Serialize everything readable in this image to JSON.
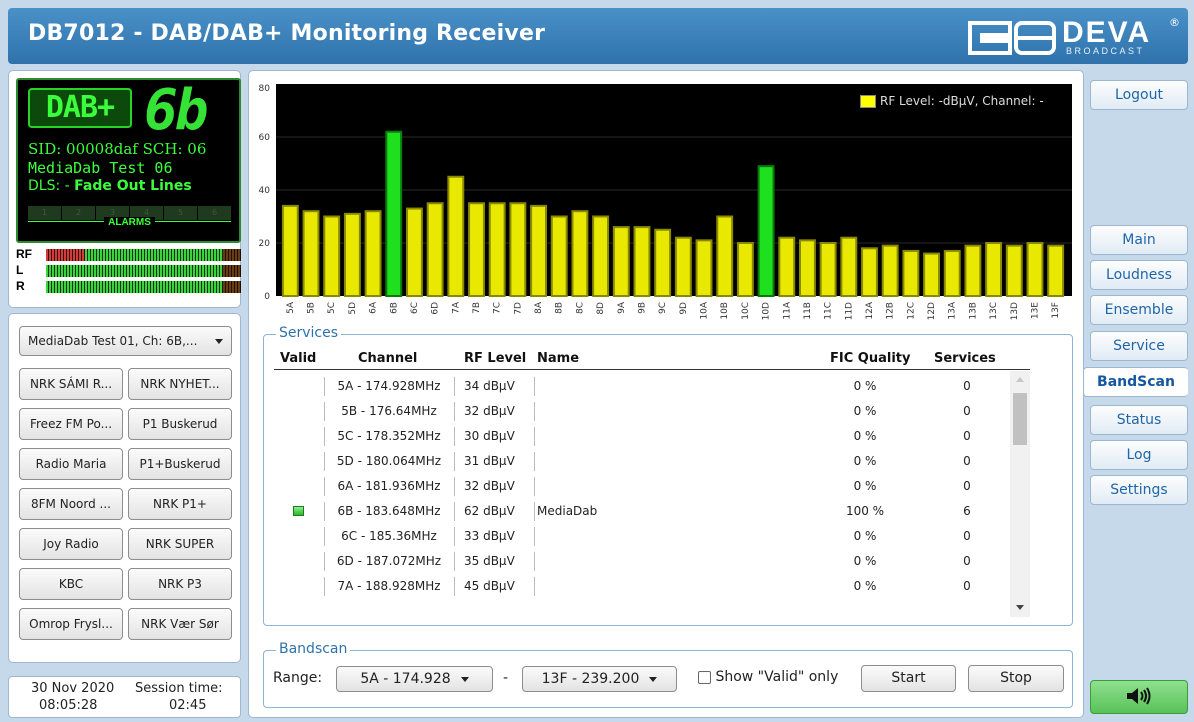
{
  "header": {
    "title": "DB7012 - DAB/DAB+ Monitoring Receiver",
    "logo_word": "DEVA",
    "logo_sub": "BROADCAST",
    "logo_reg": "®"
  },
  "display": {
    "dab_logo": "DAB+",
    "channel": "6b",
    "sid_line": "SID: 00008daf  SCH: 06",
    "ensemble": "MediaDab Test 06",
    "dls_prefix": "DLS: -",
    "dls_text": "Fade Out Lines",
    "alarm_numbers": [
      "1",
      "2",
      "3",
      "4",
      "5",
      "6"
    ],
    "alarms_label": "ALARMS"
  },
  "meters": [
    {
      "label": "RF",
      "level": 0.95,
      "red": 0.2
    },
    {
      "label": "L",
      "level": 0.9,
      "red": 0
    },
    {
      "label": "R",
      "level": 0.9,
      "red": 0
    }
  ],
  "presets": {
    "selected": "MediaDab Test 01, Ch: 6B,...",
    "buttons": [
      "NRK SÁMI R...",
      "NRK NYHET...",
      "Freez FM Po...",
      "P1 Buskerud",
      "Radio Maria",
      "P1+Buskerud",
      "8FM Noord ...",
      "NRK P1+",
      "Joy Radio",
      "NRK SUPER",
      "KBC",
      "NRK P3",
      "Omrop Frysl...",
      "NRK Vær Sør"
    ]
  },
  "footer": {
    "date": "30 Nov 2020",
    "time": "08:05:28",
    "session_label": "Session time:",
    "session_value": "02:45"
  },
  "nav": {
    "logout": "Logout",
    "items": [
      "Main",
      "Loudness",
      "Ensemble",
      "Service",
      "BandScan",
      "Status",
      "Log",
      "Settings"
    ],
    "active": "BandScan"
  },
  "chart_data": {
    "type": "bar",
    "legend": "RF Level: -dBµV, Channel: -",
    "ylim": [
      0,
      80
    ],
    "yticks": [
      0,
      20,
      40,
      60,
      80
    ],
    "categories": [
      "5A",
      "5B",
      "5C",
      "5D",
      "6A",
      "6B",
      "6C",
      "6D",
      "7A",
      "7B",
      "7C",
      "7D",
      "8A",
      "8B",
      "8C",
      "8D",
      "9A",
      "9B",
      "9C",
      "9D",
      "10A",
      "10B",
      "10C",
      "10D",
      "11A",
      "11B",
      "11C",
      "11D",
      "12A",
      "12B",
      "12C",
      "12D",
      "13A",
      "13B",
      "13C",
      "13D",
      "13E",
      "13F"
    ],
    "values": [
      34,
      32,
      30,
      31,
      32,
      62,
      33,
      35,
      45,
      35,
      35,
      35,
      34,
      30,
      32,
      30,
      26,
      26,
      25,
      22,
      21,
      30,
      20,
      49,
      22,
      21,
      20,
      22,
      18,
      19,
      17,
      16,
      17,
      19,
      20,
      19,
      20,
      19
    ],
    "valid": [
      "6B",
      "10D"
    ],
    "colors": {
      "bar": "#e8e800",
      "bar_edge": "#8a8a00",
      "valid_bar": "#1ee01e",
      "valid_edge": "#0a7a0a",
      "background": "#000000",
      "grid": "#2a2a2a"
    }
  },
  "services": {
    "legend": "Services",
    "headers": {
      "valid": "Valid",
      "channel": "Channel",
      "rf": "RF Level",
      "name": "Name",
      "fic": "FIC Quality",
      "services": "Services"
    },
    "rows": [
      {
        "valid": false,
        "channel": "5A - 174.928MHz",
        "rf": "34 dBµV",
        "name": "",
        "fic": "0 %",
        "services": "0"
      },
      {
        "valid": false,
        "channel": "5B - 176.64MHz",
        "rf": "32 dBµV",
        "name": "",
        "fic": "0 %",
        "services": "0"
      },
      {
        "valid": false,
        "channel": "5C - 178.352MHz",
        "rf": "30 dBµV",
        "name": "",
        "fic": "0 %",
        "services": "0"
      },
      {
        "valid": false,
        "channel": "5D - 180.064MHz",
        "rf": "31 dBµV",
        "name": "",
        "fic": "0 %",
        "services": "0"
      },
      {
        "valid": false,
        "channel": "6A - 181.936MHz",
        "rf": "32 dBµV",
        "name": "",
        "fic": "0 %",
        "services": "0"
      },
      {
        "valid": true,
        "channel": "6B - 183.648MHz",
        "rf": "62 dBµV",
        "name": "MediaDab",
        "fic": "100 %",
        "services": "6"
      },
      {
        "valid": false,
        "channel": "6C - 185.36MHz",
        "rf": "33 dBµV",
        "name": "",
        "fic": "0 %",
        "services": "0"
      },
      {
        "valid": false,
        "channel": "6D - 187.072MHz",
        "rf": "35 dBµV",
        "name": "",
        "fic": "0 %",
        "services": "0"
      },
      {
        "valid": false,
        "channel": "7A - 188.928MHz",
        "rf": "45 dBµV",
        "name": "",
        "fic": "0 %",
        "services": "0"
      }
    ]
  },
  "bandscan": {
    "legend": "Bandscan",
    "range_label": "Range:",
    "range_from": "5A - 174.928",
    "separator": "-",
    "range_to": "13F - 239.200",
    "valid_only_label": "Show \"Valid\" only",
    "valid_only_checked": false,
    "start": "Start",
    "stop": "Stop"
  }
}
